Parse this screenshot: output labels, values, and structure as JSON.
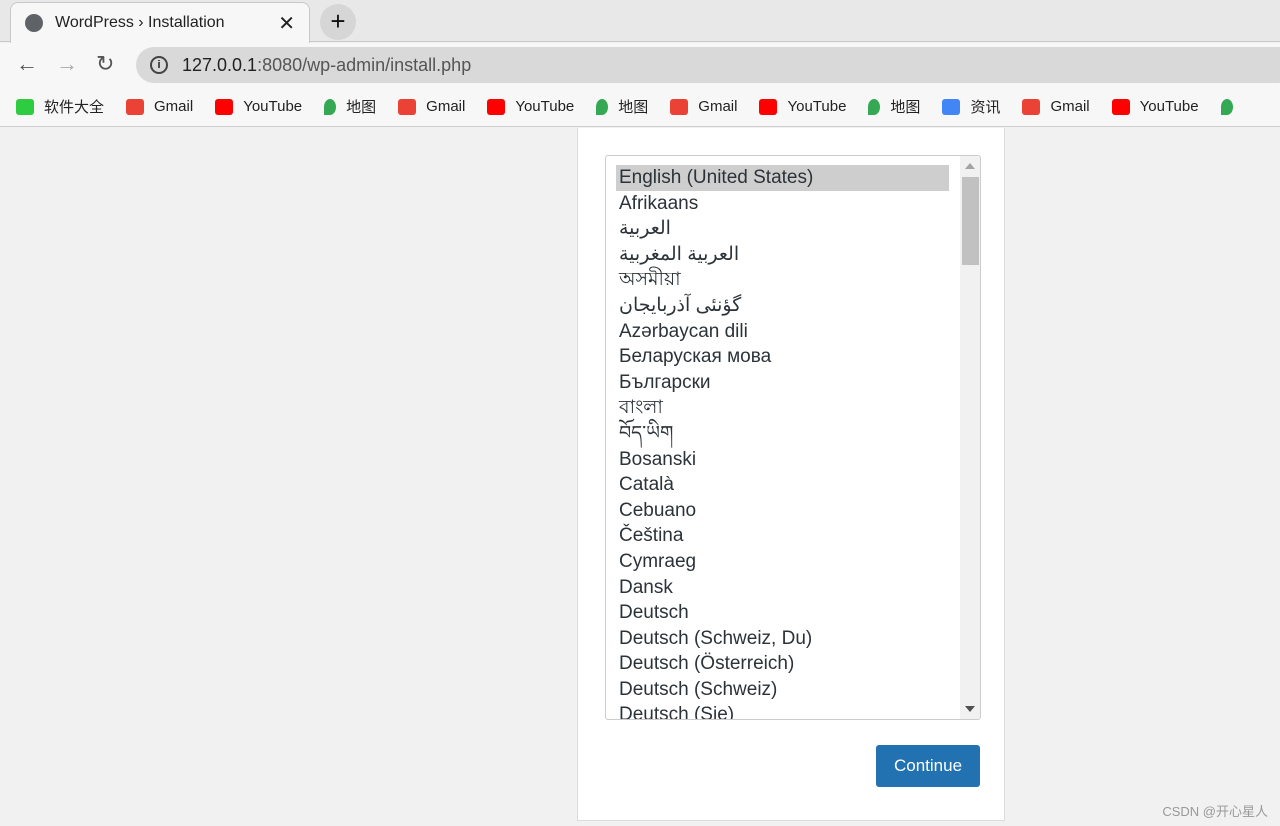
{
  "browser": {
    "tab_title": "WordPress › Installation",
    "url_host": "127.0.0.1",
    "url_rest": ":8080/wp-admin/install.php"
  },
  "bookmarks": [
    {
      "label": "软件大全",
      "icon": "download-icon",
      "color": "#2ecc40"
    },
    {
      "label": "Gmail",
      "icon": "gmail-icon",
      "color": "#ea4335"
    },
    {
      "label": "YouTube",
      "icon": "youtube-icon",
      "color": "#ff0000"
    },
    {
      "label": "地图",
      "icon": "maps-icon",
      "color": "#34a853"
    },
    {
      "label": "Gmail",
      "icon": "gmail-icon",
      "color": "#ea4335"
    },
    {
      "label": "YouTube",
      "icon": "youtube-icon",
      "color": "#ff0000"
    },
    {
      "label": "地图",
      "icon": "maps-icon",
      "color": "#34a853"
    },
    {
      "label": "Gmail",
      "icon": "gmail-icon",
      "color": "#ea4335"
    },
    {
      "label": "YouTube",
      "icon": "youtube-icon",
      "color": "#ff0000"
    },
    {
      "label": "地图",
      "icon": "maps-icon",
      "color": "#34a853"
    },
    {
      "label": "资讯",
      "icon": "news-icon",
      "color": "#4285f4"
    },
    {
      "label": "Gmail",
      "icon": "gmail-icon",
      "color": "#ea4335"
    },
    {
      "label": "YouTube",
      "icon": "youtube-icon",
      "color": "#ff0000"
    },
    {
      "label": "",
      "icon": "maps-icon",
      "color": "#34a853"
    }
  ],
  "languages": {
    "selected": "English (United States)",
    "options": [
      "English (United States)",
      "Afrikaans",
      "العربية",
      "العربية المغربية",
      "অসমীয়া",
      "گؤنئی آذربایجان",
      "Azərbaycan dili",
      "Беларуская мова",
      "Български",
      "বাংলা",
      "བོད་ཡིག",
      "Bosanski",
      "Català",
      "Cebuano",
      "Čeština",
      "Cymraeg",
      "Dansk",
      "Deutsch",
      "Deutsch (Schweiz, Du)",
      "Deutsch (Österreich)",
      "Deutsch (Schweiz)",
      "Deutsch (Sie)"
    ]
  },
  "continue_label": "Continue",
  "accent": "#2271b1",
  "watermark": "CSDN @开心星人"
}
